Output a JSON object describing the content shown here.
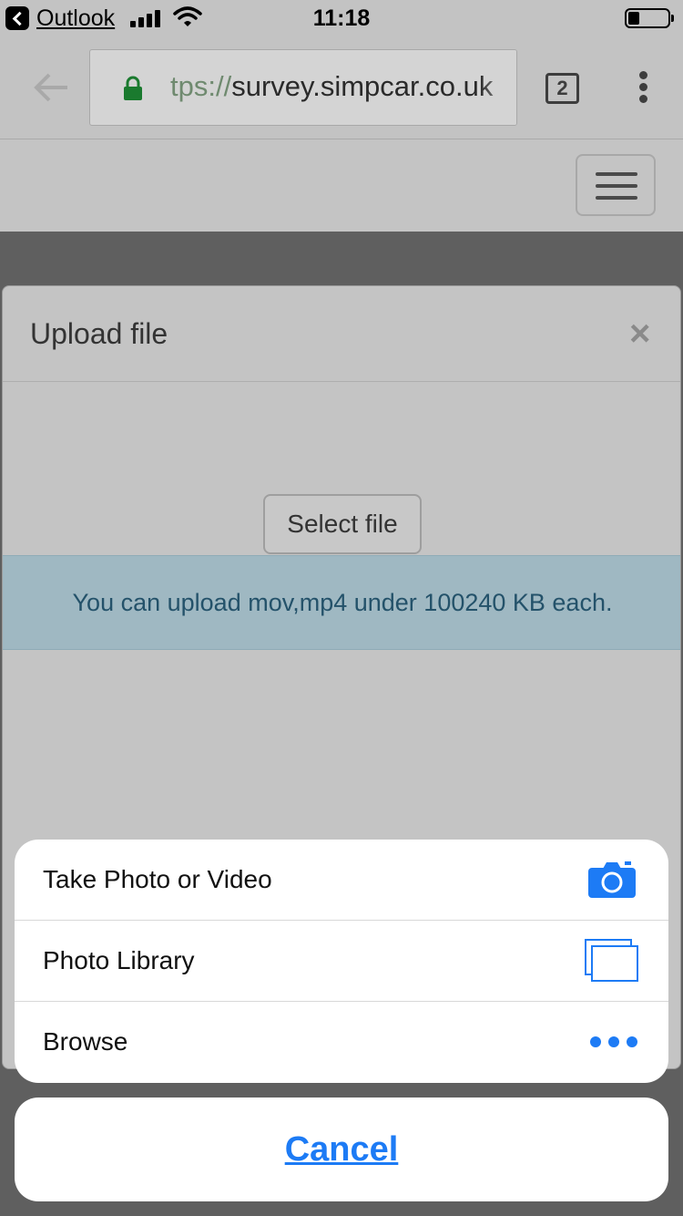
{
  "status_bar": {
    "back_app_label": "Outlook",
    "time": "11:18"
  },
  "browser": {
    "url_protocol_fragment": "tps://",
    "url_host": "survey.simpcar.co.uk",
    "tab_count": "2"
  },
  "modal": {
    "title": "Upload file",
    "close_glyph": "×",
    "select_file_label": "Select file",
    "info_text": "You can upload mov,mp4 under 100240 KB each."
  },
  "action_sheet": {
    "items": [
      {
        "label": "Take Photo or Video",
        "icon": "camera-icon"
      },
      {
        "label": "Photo Library",
        "icon": "photo-library-icon"
      },
      {
        "label": "Browse",
        "icon": "more-dots-icon"
      }
    ],
    "cancel_label": "Cancel",
    "accent_color": "#1d7bf5"
  }
}
